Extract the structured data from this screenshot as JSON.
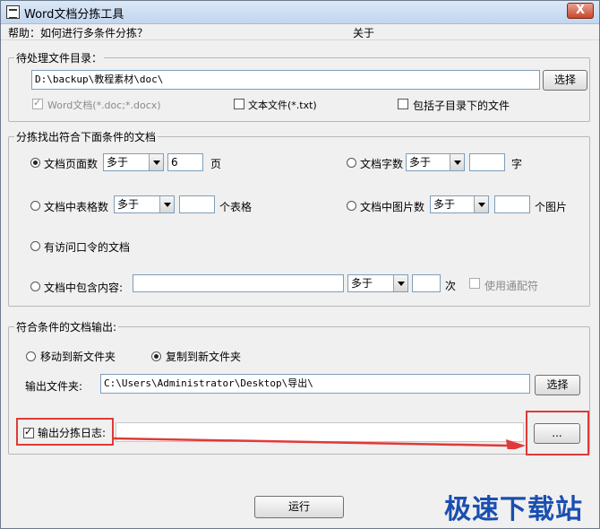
{
  "window": {
    "title": "Word文档分拣工具",
    "close_label": "X"
  },
  "menu": {
    "help": "帮助：如何进行多条件分拣？",
    "about": "关于"
  },
  "source": {
    "group_label": "待处理文件目录：",
    "path": "D:\\backup\\教程素材\\doc\\",
    "browse_label": "选择",
    "word_label": "Word文档(*.doc;*.docx)",
    "word_checked": true,
    "text_label": "文本文件(*.txt)",
    "text_checked": false,
    "subdir_label": "包括子目录下的文件",
    "subdir_checked": false
  },
  "filter": {
    "group_label": "分拣找出符合下面条件的文档",
    "page_count": {
      "label": "文档页面数",
      "op": "多于",
      "value": "6",
      "unit": "页",
      "selected": true
    },
    "word_count": {
      "label": "文档字数",
      "op": "多于",
      "value": "",
      "unit": "字",
      "selected": false
    },
    "table_count": {
      "label": "文档中表格数",
      "op": "多于",
      "value": "",
      "unit": "个表格",
      "selected": false
    },
    "image_count": {
      "label": "文档中图片数",
      "op": "多于",
      "value": "",
      "unit": "个图片",
      "selected": false
    },
    "password": {
      "label": "有访问口令的文档",
      "selected": false
    },
    "contains": {
      "label": "文档中包含内容:",
      "text": "",
      "op": "多于",
      "value": "",
      "unit": "次",
      "selected": false,
      "wildcard_label": "使用通配符"
    }
  },
  "output": {
    "group_label": "符合条件的文档输出:",
    "move_label": "移动到新文件夹",
    "move_selected": false,
    "copy_label": "复制到新文件夹",
    "copy_selected": true,
    "folder_label": "输出文件夹:",
    "folder_path": "C:\\Users\\Administrator\\Desktop\\导出\\",
    "browse_label": "选择",
    "log_label": "输出分拣日志:",
    "log_checked": true,
    "log_browse_label": "..."
  },
  "run_label": "运行",
  "watermark": "极速下载站",
  "colors": {
    "annotation": "#e03a3a",
    "watermark": "#1a4fb0"
  }
}
